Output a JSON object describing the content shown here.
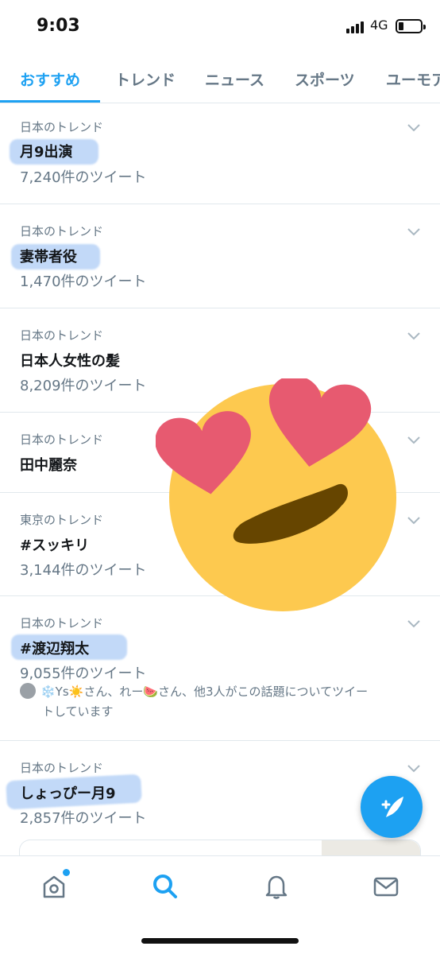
{
  "status_bar": {
    "time": "9:03",
    "network": "4G"
  },
  "tabs": [
    {
      "label": "おすすめ",
      "active": true
    },
    {
      "label": "トレンド",
      "active": false
    },
    {
      "label": "ニュース",
      "active": false
    },
    {
      "label": "スポーツ",
      "active": false
    },
    {
      "label": "ユーモア",
      "active": false
    }
  ],
  "trends": [
    {
      "context": "日本のトレンド",
      "name": "月9出演",
      "count": "7,240件のツイート"
    },
    {
      "context": "日本のトレンド",
      "name": "妻帯者役",
      "count": "1,470件のツイート"
    },
    {
      "context": "日本のトレンド",
      "name": "日本人女性の髪",
      "count": "8,209件のツイート"
    },
    {
      "context": "日本のトレンド",
      "name": "田中麗奈"
    },
    {
      "context": "東京のトレンド",
      "name": "#スッキリ",
      "count": "3,144件のツイート"
    },
    {
      "context": "日本のトレンド",
      "name": "#渡辺翔太",
      "count": "9,055件のツイート",
      "social_line1": "❄️Ys☀️さん、れー🍉さん、他3人がこの話題についてツイー",
      "social_line2": "トしています"
    },
    {
      "context": "日本のトレンド",
      "name": "しょっぴー月9",
      "count": "2,857件のツイート"
    }
  ],
  "colors": {
    "accent": "#1da1f2",
    "muted": "#657786",
    "text": "#14171a",
    "heart": "#e75a70",
    "face": "#fdc94f"
  },
  "icons": {
    "emoji": "smiling-face-with-heart-eyes-icon",
    "compose": "compose-tweet-icon",
    "home": "home-icon",
    "search": "search-icon",
    "notifications": "bell-icon",
    "messages": "mail-icon"
  }
}
